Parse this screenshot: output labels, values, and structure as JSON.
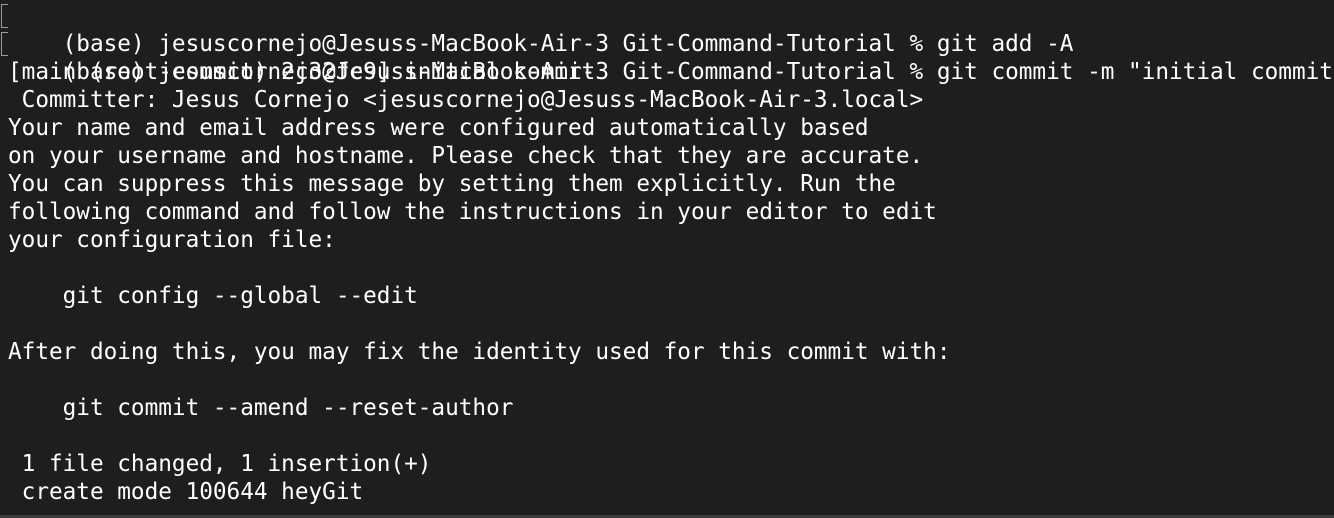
{
  "terminal": {
    "lines": [
      {
        "text": "(base) jesuscornejo@Jesuss-MacBook-Air-3 Git-Command-Tutorial % git add -A",
        "prompt": true
      },
      {
        "text": "(base) jesuscornejo@Jesuss-MacBook-Air-3 Git-Command-Tutorial % git commit -m \"initial commit\"",
        "prompt": true
      },
      {
        "text": "[main (root-commit) 2c32fc9] initial commit",
        "prompt": false
      },
      {
        "text": " Committer: Jesus Cornejo <jesuscornejo@Jesuss-MacBook-Air-3.local>",
        "prompt": false
      },
      {
        "text": "Your name and email address were configured automatically based",
        "prompt": false
      },
      {
        "text": "on your username and hostname. Please check that they are accurate.",
        "prompt": false
      },
      {
        "text": "You can suppress this message by setting them explicitly. Run the",
        "prompt": false
      },
      {
        "text": "following command and follow the instructions in your editor to edit",
        "prompt": false
      },
      {
        "text": "your configuration file:",
        "prompt": false
      },
      {
        "text": "",
        "prompt": false
      },
      {
        "text": "    git config --global --edit",
        "prompt": false
      },
      {
        "text": "",
        "prompt": false
      },
      {
        "text": "After doing this, you may fix the identity used for this commit with:",
        "prompt": false
      },
      {
        "text": "",
        "prompt": false
      },
      {
        "text": "    git commit --amend --reset-author",
        "prompt": false
      },
      {
        "text": "",
        "prompt": false
      },
      {
        "text": " 1 file changed, 1 insertion(+)",
        "prompt": false
      },
      {
        "text": " create mode 100644 heyGit",
        "prompt": false
      }
    ]
  }
}
